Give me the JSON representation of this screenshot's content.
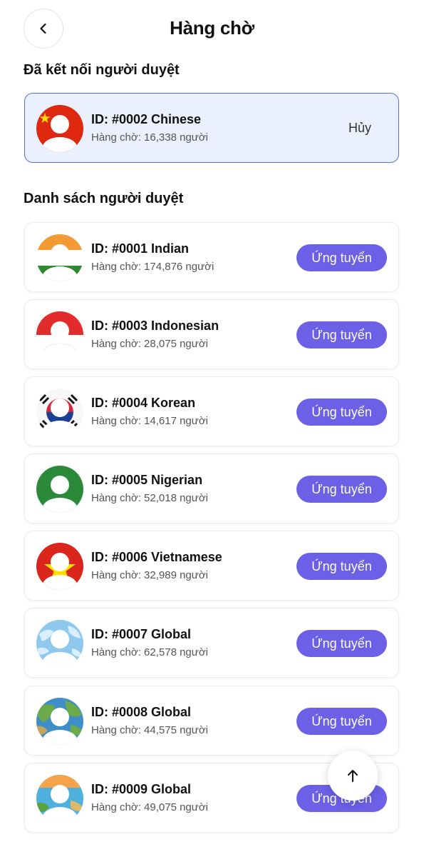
{
  "header": {
    "title": "Hàng chờ"
  },
  "connected_section": {
    "title": "Đã kết nối người duyệt",
    "reviewer": {
      "id_label": "ID: #0002 Chinese",
      "queue_label": "Hàng chờ: 16,338 người",
      "action_label": "Hủy",
      "flag": "china"
    }
  },
  "list_section": {
    "title": "Danh sách người duyệt",
    "reviewers": [
      {
        "id_label": "ID: #0001 Indian",
        "queue_label": "Hàng chờ: 174,876 người",
        "action_label": "Ứng tuyển",
        "flag": "india"
      },
      {
        "id_label": "ID: #0003 Indonesian",
        "queue_label": "Hàng chờ: 28,075 người",
        "action_label": "Ứng tuyển",
        "flag": "indonesia"
      },
      {
        "id_label": "ID: #0004 Korean",
        "queue_label": "Hàng chờ: 14,617 người",
        "action_label": "Ứng tuyển",
        "flag": "korea"
      },
      {
        "id_label": "ID: #0005 Nigerian",
        "queue_label": "Hàng chờ: 52,018 người",
        "action_label": "Ứng tuyển",
        "flag": "nigeria"
      },
      {
        "id_label": "ID: #0006 Vietnamese",
        "queue_label": "Hàng chờ: 32,989 người",
        "action_label": "Ứng tuyển",
        "flag": "vietnam"
      },
      {
        "id_label": "ID: #0007 Global",
        "queue_label": "Hàng chờ: 62,578 người",
        "action_label": "Ứng tuyển",
        "flag": "global-light"
      },
      {
        "id_label": "ID: #0008 Global",
        "queue_label": "Hàng chờ: 44,575 người",
        "action_label": "Ứng tuyển",
        "flag": "global-green"
      },
      {
        "id_label": "ID: #0009 Global",
        "queue_label": "Hàng chờ: 49,075 người",
        "action_label": "Ứng tuyển",
        "flag": "global-beach"
      }
    ]
  },
  "icons": {
    "back": "chevron-left-icon",
    "scroll_top": "arrow-up-icon"
  },
  "colors": {
    "accent": "#6b60e6",
    "connected_bg": "#eaf0fd",
    "connected_border": "#5672c9"
  }
}
